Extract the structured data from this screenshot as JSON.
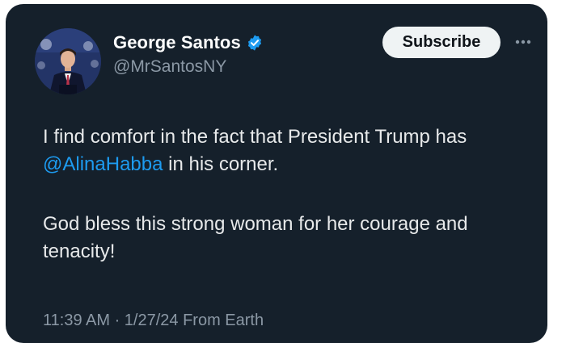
{
  "author": {
    "display_name": "George Santos",
    "handle": "@MrSantosNY",
    "verified": true
  },
  "actions": {
    "subscribe_label": "Subscribe",
    "more_icon": "more-horizontal-icon"
  },
  "tweet": {
    "line1_before": "I find comfort in the fact that President Trump has ",
    "mention": "@AlinaHabba",
    "line1_after": " in his corner.",
    "paragraph2": "God bless this strong woman for her courage and tenacity!"
  },
  "meta": {
    "timestamp": "11:39 AM · 1/27/24 From Earth"
  },
  "colors": {
    "card_bg": "#15202b",
    "text": "#e7e9ea",
    "muted": "#8b98a5",
    "accent": "#1d9bf0"
  }
}
